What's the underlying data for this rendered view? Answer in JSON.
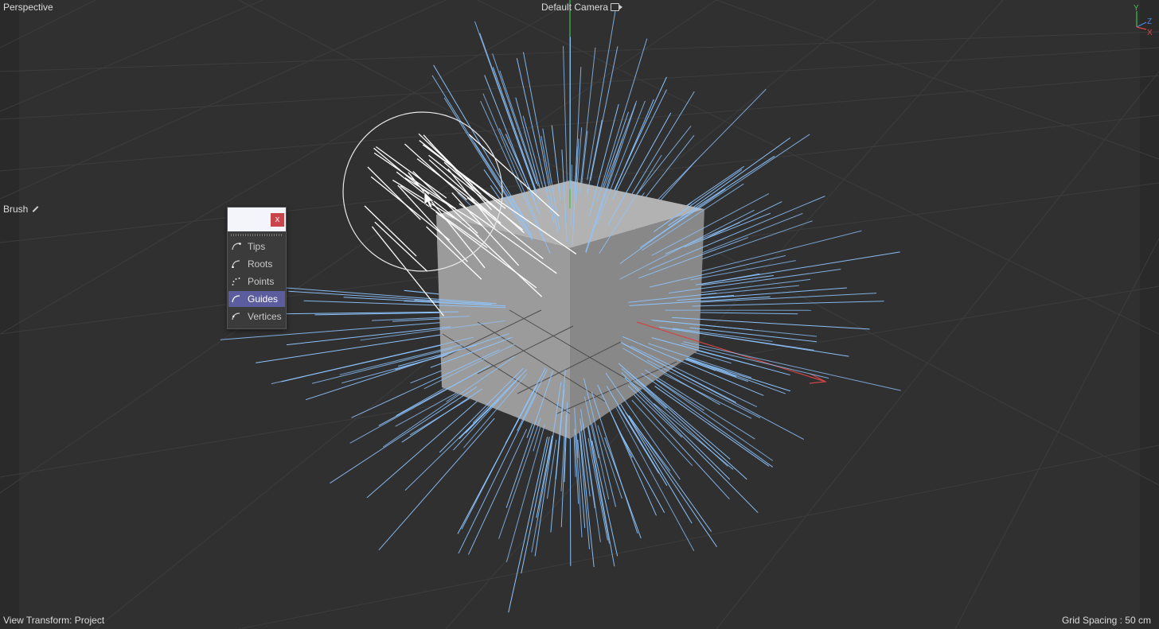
{
  "viewport": {
    "view_name": "Perspective",
    "camera": "Default Camera",
    "camera_icon": "camera-icon",
    "tool": "Brush",
    "tool_icon": "pen-icon",
    "view_transform": "View Transform: Project",
    "grid_spacing": "Grid Spacing : 50 cm",
    "background_color": "#303030",
    "grid_color": "#3c3c3c",
    "hair_color": "#8ec5ff",
    "selected_hair_color": "#ffffff",
    "cube_color": "#9a9a9a"
  },
  "axis_gizmo": {
    "y_label": "Y",
    "z_label": "Z",
    "x_label": "X",
    "y_color": "#3fbf4f",
    "z_color": "#4a86e0",
    "x_color": "#e04545"
  },
  "mode_popup": {
    "close_label": "x",
    "close_icon": "close-icon",
    "items": [
      {
        "label": "Tips",
        "icon": "tips-icon",
        "selected": false
      },
      {
        "label": "Roots",
        "icon": "roots-icon",
        "selected": false
      },
      {
        "label": "Points",
        "icon": "points-icon",
        "selected": false
      },
      {
        "label": "Guides",
        "icon": "guides-icon",
        "selected": true
      },
      {
        "label": "Vertices",
        "icon": "vertices-icon",
        "selected": false
      }
    ],
    "selected_color": "#5b5d9e"
  }
}
